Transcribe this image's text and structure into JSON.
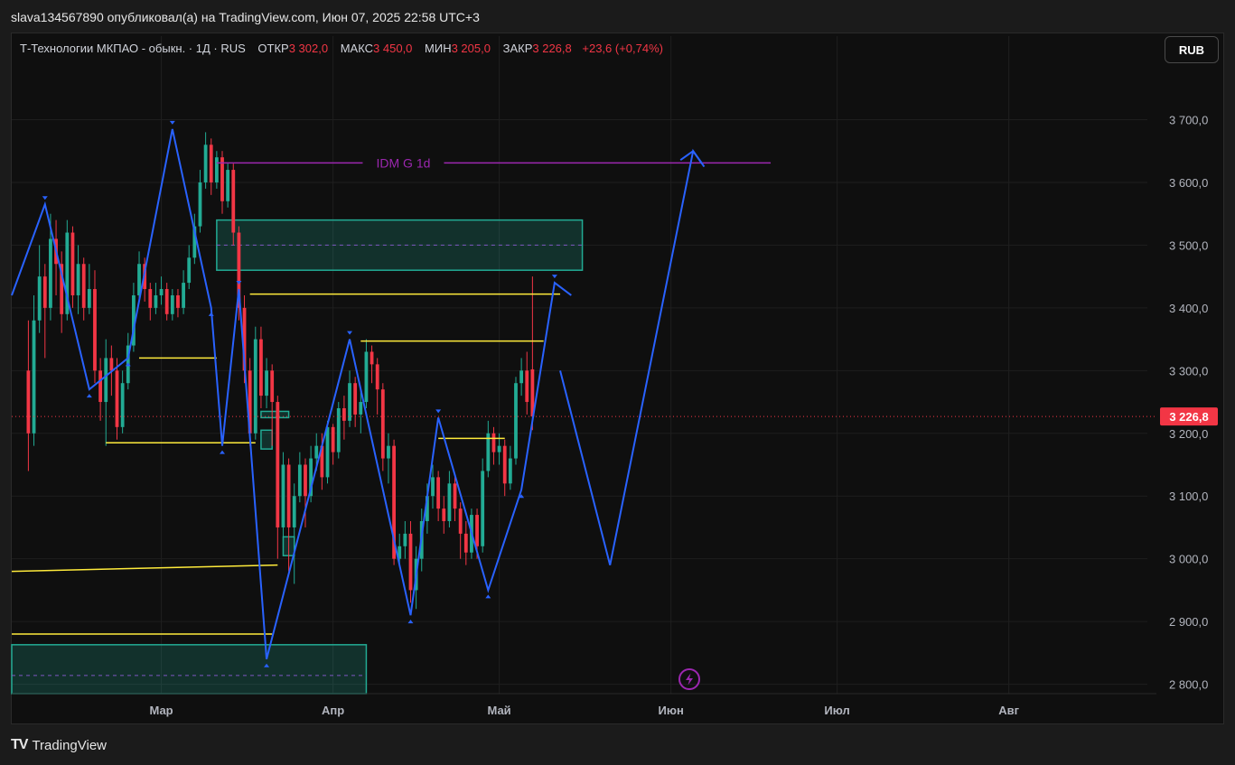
{
  "header": {
    "caption": "slava134567890 опубликовал(а) на TradingView.com, Июн 07, 2025 22:58 UTC+3"
  },
  "legend": {
    "symbol": "Т-Технологии МКПАО - обыкн. · 1Д · RUS",
    "open_label": "ОТКР",
    "open_value": "3 302,0",
    "high_label": "МАКС",
    "high_value": "3 450,0",
    "low_label": "МИН",
    "low_value": "3 205,0",
    "close_label": "ЗАКР",
    "close_value": "3 226,8",
    "change": "+23,6 (+0,74%)"
  },
  "currency_button": "RUB",
  "footer": {
    "brand": "TradingView",
    "logo_text": "TV"
  },
  "colors": {
    "up": "#22ab94",
    "down": "#f23645",
    "zigzag": "#2962ff",
    "level": "#ffeb3b",
    "idm": "#9c27b0",
    "zone": "#22ab94",
    "background": "#0f0f0f"
  },
  "chart_data": {
    "type": "candlestick",
    "y_axis": {
      "ticks": [
        "3 700,0",
        "3 600,0",
        "3 500,0",
        "3 400,0",
        "3 300,0",
        "3 200,0",
        "3 100,0",
        "3 000,0",
        "2 900,0",
        "2 800,0"
      ],
      "tick_values": [
        3700,
        3600,
        3500,
        3400,
        3300,
        3200,
        3100,
        3000,
        2900,
        2800
      ],
      "ylim": [
        2785,
        3790
      ]
    },
    "x_axis": {
      "labels": [
        "Мар",
        "Апр",
        "Май",
        "Июн",
        "Июл",
        "Авг"
      ],
      "label_days": [
        24,
        55,
        85,
        116,
        146,
        177
      ],
      "xlim": [
        -3,
        202
      ]
    },
    "last_price": {
      "value": 3226.8,
      "label": "3 226,8"
    },
    "candles": [
      [
        0,
        3300,
        3200,
        3380,
        3140
      ],
      [
        1,
        3200,
        3380,
        3420,
        3180
      ],
      [
        2,
        3380,
        3450,
        3500,
        3360
      ],
      [
        3,
        3450,
        3400,
        3470,
        3320
      ],
      [
        4,
        3400,
        3510,
        3550,
        3380
      ],
      [
        5,
        3510,
        3470,
        3540,
        3420
      ],
      [
        6,
        3470,
        3390,
        3490,
        3360
      ],
      [
        7,
        3390,
        3520,
        3540,
        3380
      ],
      [
        8,
        3520,
        3420,
        3530,
        3400
      ],
      [
        9,
        3420,
        3470,
        3500,
        3390
      ],
      [
        10,
        3470,
        3400,
        3480,
        3380
      ],
      [
        11,
        3400,
        3430,
        3470,
        3390
      ],
      [
        12,
        3430,
        3300,
        3460,
        3280
      ],
      [
        13,
        3300,
        3250,
        3320,
        3220
      ],
      [
        14,
        3250,
        3320,
        3350,
        3180
      ],
      [
        15,
        3320,
        3300,
        3340,
        3260
      ],
      [
        16,
        3300,
        3210,
        3320,
        3190
      ],
      [
        17,
        3210,
        3280,
        3300,
        3200
      ],
      [
        18,
        3280,
        3340,
        3360,
        3270
      ],
      [
        19,
        3340,
        3420,
        3440,
        3330
      ],
      [
        20,
        3420,
        3470,
        3490,
        3410
      ],
      [
        21,
        3470,
        3430,
        3480,
        3410
      ],
      [
        22,
        3430,
        3400,
        3440,
        3380
      ],
      [
        23,
        3400,
        3420,
        3440,
        3390
      ],
      [
        24,
        3420,
        3430,
        3450,
        3405
      ],
      [
        25,
        3430,
        3390,
        3440,
        3380
      ],
      [
        26,
        3390,
        3420,
        3430,
        3380
      ],
      [
        27,
        3420,
        3400,
        3430,
        3385
      ],
      [
        28,
        3400,
        3440,
        3460,
        3390
      ],
      [
        29,
        3440,
        3480,
        3500,
        3430
      ],
      [
        30,
        3480,
        3530,
        3550,
        3470
      ],
      [
        31,
        3530,
        3600,
        3620,
        3520
      ],
      [
        32,
        3600,
        3660,
        3680,
        3590
      ],
      [
        33,
        3660,
        3600,
        3670,
        3580
      ],
      [
        34,
        3600,
        3640,
        3650,
        3590
      ],
      [
        35,
        3640,
        3570,
        3650,
        3550
      ],
      [
        36,
        3570,
        3620,
        3630,
        3560
      ],
      [
        37,
        3620,
        3520,
        3630,
        3500
      ],
      [
        38,
        3520,
        3400,
        3530,
        3380
      ],
      [
        39,
        3400,
        3300,
        3420,
        3280
      ],
      [
        40,
        3300,
        3200,
        3320,
        3180
      ],
      [
        41,
        3200,
        3350,
        3370,
        3190
      ],
      [
        42,
        3350,
        3260,
        3370,
        3240
      ],
      [
        43,
        3260,
        3300,
        3320,
        3240
      ],
      [
        44,
        3300,
        3250,
        3310,
        3180
      ],
      [
        45,
        3250,
        3050,
        3260,
        3000
      ],
      [
        46,
        3050,
        3150,
        3170,
        3020
      ],
      [
        47,
        3150,
        3050,
        3160,
        2980
      ],
      [
        48,
        3050,
        3100,
        3120,
        2960
      ],
      [
        49,
        3100,
        3150,
        3170,
        3090
      ],
      [
        50,
        3150,
        3100,
        3160,
        3050
      ],
      [
        51,
        3100,
        3160,
        3180,
        3090
      ],
      [
        52,
        3160,
        3180,
        3200,
        3140
      ],
      [
        53,
        3180,
        3130,
        3200,
        3110
      ],
      [
        54,
        3130,
        3210,
        3220,
        3120
      ],
      [
        55,
        3210,
        3170,
        3215,
        3150
      ],
      [
        56,
        3170,
        3240,
        3250,
        3160
      ],
      [
        57,
        3240,
        3220,
        3260,
        3190
      ],
      [
        58,
        3220,
        3280,
        3300,
        3210
      ],
      [
        59,
        3280,
        3230,
        3290,
        3210
      ],
      [
        60,
        3230,
        3250,
        3270,
        3200
      ],
      [
        61,
        3250,
        3330,
        3350,
        3240
      ],
      [
        62,
        3330,
        3310,
        3340,
        3280
      ],
      [
        63,
        3310,
        3270,
        3320,
        3230
      ],
      [
        64,
        3270,
        3160,
        3280,
        3140
      ],
      [
        65,
        3160,
        3180,
        3200,
        3120
      ],
      [
        66,
        3180,
        3000,
        3190,
        2990
      ],
      [
        67,
        3000,
        3020,
        3040,
        2990
      ],
      [
        68,
        3020,
        3040,
        3060,
        3000
      ],
      [
        69,
        3040,
        2950,
        3060,
        2930
      ],
      [
        70,
        2950,
        3000,
        3020,
        2920
      ],
      [
        71,
        3000,
        3060,
        3080,
        2980
      ],
      [
        72,
        3060,
        3100,
        3120,
        3040
      ],
      [
        73,
        3100,
        3130,
        3150,
        3080
      ],
      [
        74,
        3130,
        3080,
        3140,
        3060
      ],
      [
        75,
        3080,
        3060,
        3100,
        3040
      ],
      [
        76,
        3060,
        3120,
        3140,
        3050
      ],
      [
        77,
        3120,
        3080,
        3130,
        3060
      ],
      [
        78,
        3080,
        3040,
        3090,
        3000
      ],
      [
        79,
        3040,
        3010,
        3060,
        2990
      ],
      [
        80,
        3010,
        3070,
        3080,
        3000
      ],
      [
        81,
        3070,
        3020,
        3080,
        3000
      ],
      [
        82,
        3020,
        3140,
        3160,
        3010
      ],
      [
        83,
        3140,
        3200,
        3220,
        3130
      ],
      [
        84,
        3200,
        3170,
        3210,
        3150
      ],
      [
        85,
        3170,
        3180,
        3200,
        3150
      ],
      [
        86,
        3180,
        3120,
        3190,
        3100
      ],
      [
        87,
        3120,
        3160,
        3180,
        3110
      ],
      [
        88,
        3160,
        3280,
        3290,
        3150
      ],
      [
        89,
        3280,
        3300,
        3320,
        3260
      ],
      [
        90,
        3300,
        3250,
        3330,
        3230
      ],
      [
        91,
        3302,
        3226.8,
        3450,
        3205
      ]
    ],
    "zigzag": [
      [
        -3,
        3420
      ],
      [
        3,
        3565
      ],
      [
        11,
        3270
      ],
      [
        18,
        3320
      ],
      [
        26,
        3685
      ],
      [
        33,
        3400
      ],
      [
        35,
        3180
      ],
      [
        38,
        3430
      ],
      [
        43,
        2840
      ],
      [
        58,
        3350
      ],
      [
        69,
        2910
      ],
      [
        74,
        3225
      ],
      [
        83,
        2950
      ],
      [
        89,
        3110
      ],
      [
        95,
        3440
      ],
      [
        98,
        3420
      ]
    ],
    "projection": [
      [
        96,
        3300
      ],
      [
        105,
        2990
      ],
      [
        120,
        3650
      ],
      [
        122,
        3625
      ]
    ],
    "levels": [
      {
        "y": 3631,
        "x1": 34,
        "x2": 134,
        "label": "IDM G 1d"
      },
      {
        "y": 3422,
        "x1": 40,
        "x2": 96
      },
      {
        "y": 3347,
        "x1": 60,
        "x2": 93
      },
      {
        "y": 3320,
        "x1": 20,
        "x2": 34
      },
      {
        "y": 3185,
        "x1": 14,
        "x2": 41
      },
      {
        "y": 3192,
        "x1": 74,
        "x2": 86
      },
      {
        "y": 2980,
        "y_end": 2990,
        "x1": -3,
        "x2": 45
      },
      {
        "y": 2880,
        "x1": -3,
        "x2": 44
      }
    ],
    "zones": [
      {
        "x1": 34,
        "x2": 100,
        "y_top": 3540,
        "y_bottom": 3460,
        "mid": 3500
      },
      {
        "x1": -3,
        "x2": 61,
        "y_top": 2863,
        "y_bottom": 2785,
        "mid": 2814
      },
      {
        "x1": 42,
        "x2": 47,
        "y_top": 3235,
        "y_bottom": 3225
      },
      {
        "x1": 42,
        "x2": 44,
        "y_top": 3205,
        "y_bottom": 3175
      },
      {
        "x1": 46,
        "x2": 48,
        "y_top": 3035,
        "y_bottom": 3005
      }
    ]
  }
}
